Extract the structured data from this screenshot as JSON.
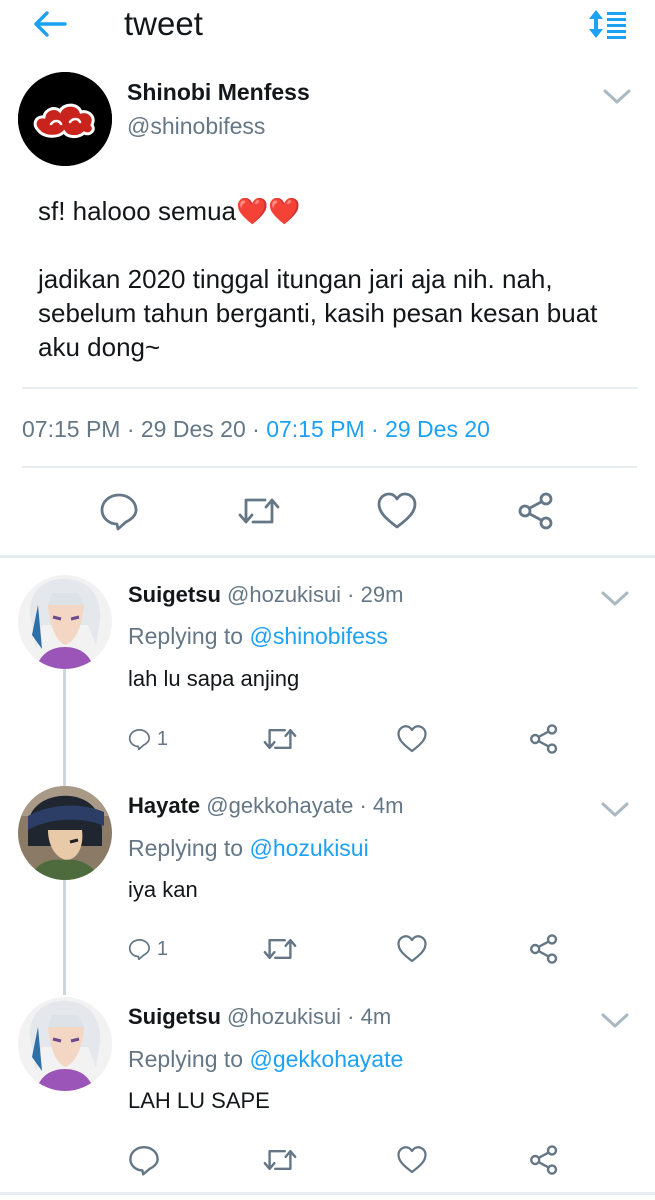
{
  "header": {
    "title": "tweet"
  },
  "main_tweet": {
    "name": "Shinobi Menfess",
    "handle": "@shinobifess",
    "body_line1": "sf! halooo semua❤️❤️",
    "body_line2": "jadikan 2020 tinggal itungan jari aja nih. nah, sebelum tahun berganti, kasih pesan kesan buat aku dong~",
    "time_plain": "07:15 PM · 29 Des 20 · ",
    "time_link": "07:15 PM · 29 Des 20"
  },
  "replies": [
    {
      "name": "Suigetsu",
      "meta": " @hozukisui · 29m",
      "replying_label": "Replying to ",
      "replying_to": "@shinobifess",
      "text": "lah lu sapa anjing",
      "reply_count": "1"
    },
    {
      "name": "Hayate",
      "meta": " @gekkohayate · 4m",
      "replying_label": "Replying to ",
      "replying_to": "@hozukisui",
      "text": "iya kan",
      "reply_count": "1"
    },
    {
      "name": "Suigetsu",
      "meta": " @hozukisui · 4m",
      "replying_label": "Replying to ",
      "replying_to": "@gekkohayate",
      "text": "LAH LU SAPE",
      "reply_count": ""
    }
  ],
  "icons": {
    "back": "arrow-left-icon",
    "sort": "sort-icon",
    "reply": "reply-icon",
    "retweet": "retweet-icon",
    "like": "heart-icon",
    "share": "share-icon",
    "menu": "chevron-down-icon"
  },
  "colors": {
    "accent": "#1da1f2",
    "muted": "#657786",
    "text": "#14171a",
    "divider": "#e6ecf0",
    "icon": "#657786"
  }
}
